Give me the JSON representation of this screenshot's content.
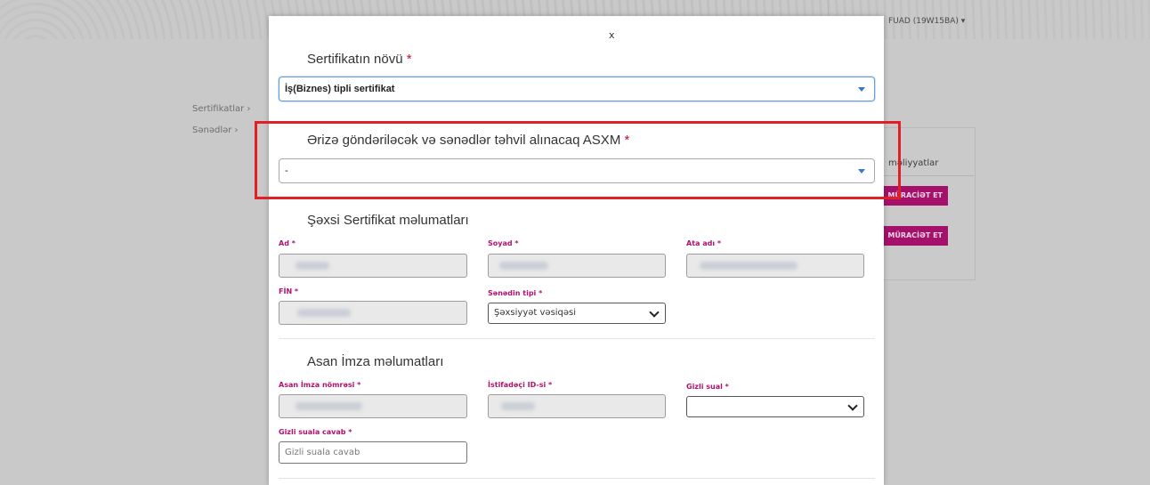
{
  "background": {
    "user_label": "FUAD (19W15BA) ▾",
    "nav": [
      "Sertifikatlar  ›",
      "Sənədlər  ›"
    ],
    "panel_title": "məliyyatlar",
    "buttons": [
      "MÜRACİƏT ET",
      "MÜRACİƏT ET"
    ]
  },
  "modal": {
    "close_label": "x",
    "certificate_type": {
      "title": "Sertifikatın növü",
      "required_mark": "*",
      "selected_value": "İş(Biznes) tipli sertifikat"
    },
    "asxm": {
      "title": "Ərizə göndəriləcək və sənədlər təhvil alınacaq ASXM",
      "required_mark": "*",
      "selected_value": "-"
    },
    "personal": {
      "title": "Şəxsi Sertifikat məlumatları",
      "fields": {
        "first_name_label": "Ad *",
        "surname_label": "Soyad *",
        "father_name_label": "Ata adı *",
        "fin_label": "FİN *",
        "doc_type_label": "Sənədin tipi *",
        "doc_type_value": "Şəxsiyyət vəsiqəsi"
      }
    },
    "asan": {
      "title": "Asan İmza məlumatları",
      "fields": {
        "number_label": "Asan İmza nömrəsi *",
        "user_id_label": "İstifadəçi ID-si *",
        "secret_question_label": "Gizli sual *",
        "secret_question_value": "",
        "secret_answer_label": "Gizli suala cavab *",
        "secret_answer_placeholder": "Gizli suala cavab"
      }
    }
  },
  "colors": {
    "required": "#c8102e",
    "label_accent": "#b0126e",
    "highlight": "#e01f26",
    "button_bg": "#a5106b"
  }
}
